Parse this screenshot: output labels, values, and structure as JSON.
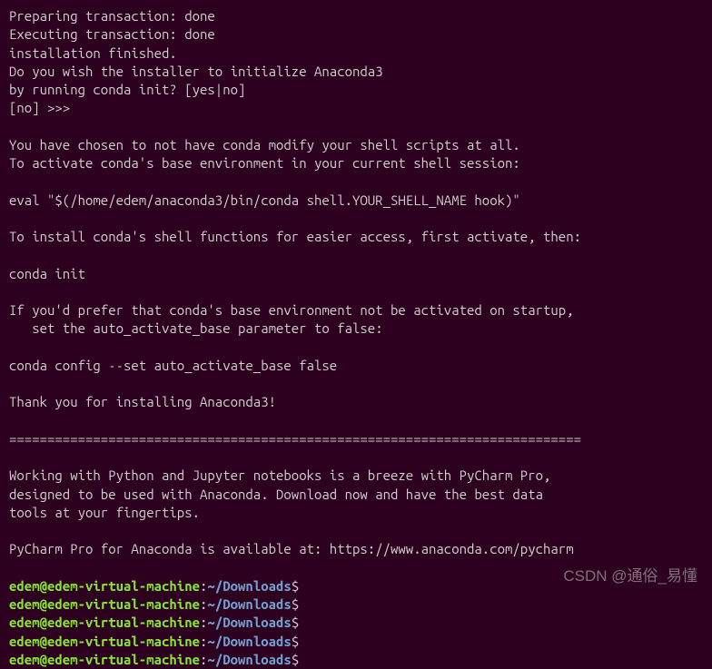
{
  "terminal": {
    "output_lines": [
      "Preparing transaction: done",
      "Executing transaction: done",
      "installation finished.",
      "Do you wish the installer to initialize Anaconda3",
      "by running conda init? [yes|no]",
      "[no] >>>",
      "",
      "You have chosen to not have conda modify your shell scripts at all.",
      "To activate conda's base environment in your current shell session:",
      "",
      "eval \"$(/home/edem/anaconda3/bin/conda shell.YOUR_SHELL_NAME hook)\"",
      "",
      "To install conda's shell functions for easier access, first activate, then:",
      "",
      "conda init",
      "",
      "If you'd prefer that conda's base environment not be activated on startup,",
      "   set the auto_activate_base parameter to false:",
      "",
      "conda config --set auto_activate_base false",
      "",
      "Thank you for installing Anaconda3!",
      "",
      "===========================================================================",
      "",
      "Working with Python and Jupyter notebooks is a breeze with PyCharm Pro,",
      "designed to be used with Anaconda. Download now and have the best data",
      "tools at your fingertips.",
      "",
      "PyCharm Pro for Anaconda is available at: https://www.anaconda.com/pycharm",
      ""
    ],
    "prompts": [
      {
        "user_host": "edem@edem-virtual-machine",
        "path": "~/Downloads",
        "input": ""
      },
      {
        "user_host": "edem@edem-virtual-machine",
        "path": "~/Downloads",
        "input": ""
      },
      {
        "user_host": "edem@edem-virtual-machine",
        "path": "~/Downloads",
        "input": ""
      },
      {
        "user_host": "edem@edem-virtual-machine",
        "path": "~/Downloads",
        "input": ""
      },
      {
        "user_host": "edem@edem-virtual-machine",
        "path": "~/Downloads",
        "input": ""
      }
    ]
  },
  "watermark": "CSDN @通俗_易懂"
}
